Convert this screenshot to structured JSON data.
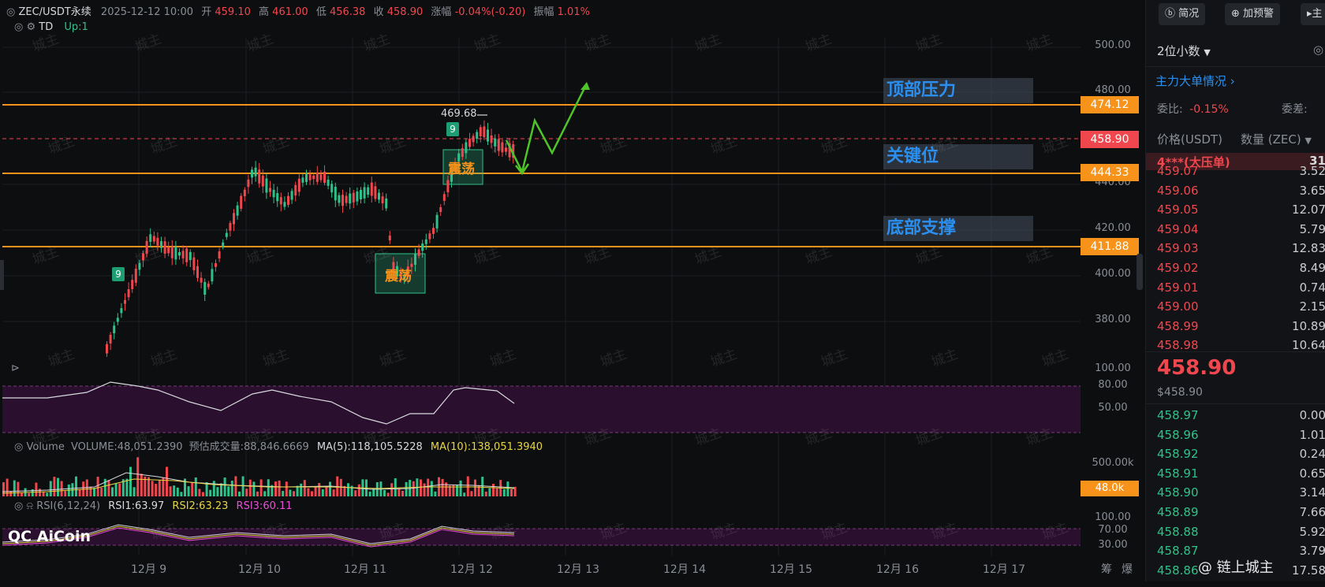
{
  "header": {
    "symbol": "ZEC/USDT永续",
    "datetime": "2025-12-12 10:00",
    "open_label": "开",
    "open": "459.10",
    "high_label": "高",
    "high": "461.00",
    "low_label": "低",
    "low": "456.38",
    "close_label": "收",
    "close": "458.90",
    "change_label": "涨幅",
    "change": "-0.04%(-0.20)",
    "amp_label": "振幅",
    "amp": "1.01%",
    "td_label": "TD",
    "td_value": "Up:1"
  },
  "y_axis": [
    "500.00",
    "480.00",
    "440.00",
    "420.00",
    "400.00",
    "380.00"
  ],
  "price_tags": {
    "resistance": "474.12",
    "current": "458.90",
    "key": "444.33",
    "support": "411.88"
  },
  "zones": {
    "top": "顶部压力",
    "key": "关键位",
    "bottom": "底部支撑"
  },
  "box_labels": [
    "震荡",
    "震荡"
  ],
  "td_tags": [
    "9",
    "9"
  ],
  "peak_label": "469.68",
  "rsi_top": {
    "ticks": [
      "100.00",
      "80.00",
      "50.00"
    ]
  },
  "volume": {
    "title": "Volume",
    "volume": "VOLUME:48,051.2390",
    "est": "预估成交量:88,846.6669",
    "ma5": "MA(5):118,105.5228",
    "ma10": "MA(10):138,051.3940",
    "tick": "500.00k",
    "tag": "48.0k"
  },
  "rsi": {
    "label": "RSI(6,12,24)",
    "rsi1": "RSI1:63.97",
    "rsi2": "RSI2:63.23",
    "rsi3": "RSI3:60.11",
    "ticks": [
      "100.00",
      "70.00",
      "30.00"
    ]
  },
  "logo": "AiCoin",
  "x_axis": [
    "12月 9",
    "12月 10",
    "12月 11",
    "12月 12",
    "12月 13",
    "12月 14",
    "12月 15",
    "12月 16",
    "12月 17"
  ],
  "footer_tabs": [
    "筹",
    "爆"
  ],
  "watermark": "城主",
  "panel": {
    "btn1": "简况",
    "btn2": "加预警",
    "btn3": "主",
    "decimals": "2位小数",
    "big_orders": "主力大单情况",
    "ratio_label": "委比:",
    "ratio": "-0.15%",
    "diff_label": "委差:",
    "col_price": "价格(USDT)",
    "col_qty": "数量 (ZEC)",
    "big_order_row": {
      "label": "4***(大压单)",
      "qty": "31"
    },
    "asks": [
      {
        "p": "459.07",
        "q": "3.52"
      },
      {
        "p": "459.06",
        "q": "3.65"
      },
      {
        "p": "459.05",
        "q": "12.07"
      },
      {
        "p": "459.04",
        "q": "5.79"
      },
      {
        "p": "459.03",
        "q": "12.83"
      },
      {
        "p": "459.02",
        "q": "8.49"
      },
      {
        "p": "459.01",
        "q": "0.74"
      },
      {
        "p": "459.00",
        "q": "2.15"
      },
      {
        "p": "458.99",
        "q": "10.89"
      },
      {
        "p": "458.98",
        "q": "10.64"
      }
    ],
    "last_price": "458.90",
    "last_price_usd": "$458.90",
    "bids": [
      {
        "p": "458.97",
        "q": "0.00"
      },
      {
        "p": "458.96",
        "q": "1.01"
      },
      {
        "p": "458.92",
        "q": "0.24"
      },
      {
        "p": "458.91",
        "q": "0.65"
      },
      {
        "p": "458.90",
        "q": "3.14"
      },
      {
        "p": "458.89",
        "q": "7.66"
      },
      {
        "p": "458.88",
        "q": "5.92"
      },
      {
        "p": "458.87",
        "q": "3.79"
      },
      {
        "p": "458.86",
        "q": "17.58"
      }
    ],
    "author": "@ 链上城主"
  },
  "colors": {
    "up": "#2ec28a",
    "down": "#f0474e",
    "level": "#f7931a",
    "zone_text": "#2b8ff0",
    "rsi_band": "#3a1540"
  }
}
